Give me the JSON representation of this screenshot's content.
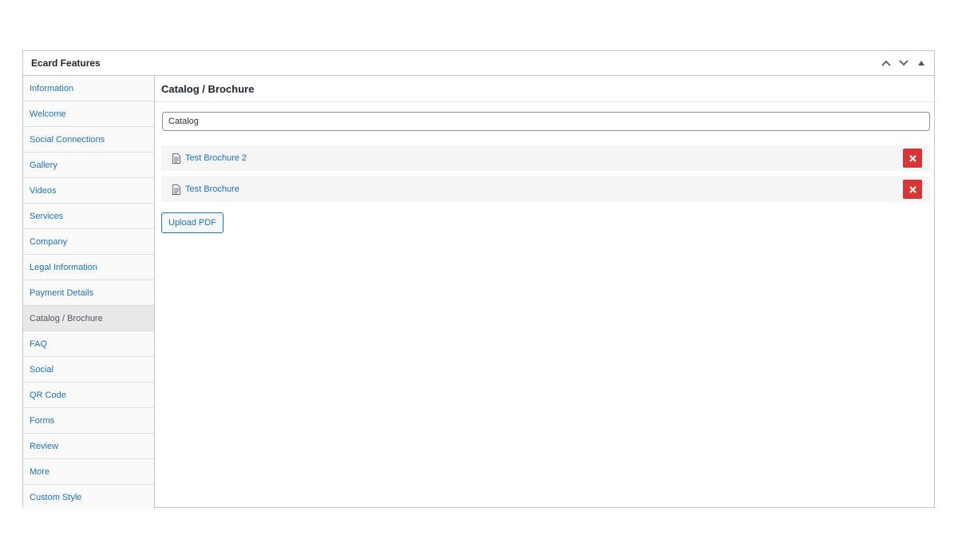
{
  "metabox": {
    "title": "Ecard Features",
    "controls": [
      "chevron-up-icon",
      "chevron-down-icon",
      "triangle-up-icon"
    ]
  },
  "tabs": [
    {
      "label": "Information"
    },
    {
      "label": "Welcome"
    },
    {
      "label": "Social Connections"
    },
    {
      "label": "Gallery"
    },
    {
      "label": "Videos"
    },
    {
      "label": "Services"
    },
    {
      "label": "Company"
    },
    {
      "label": "Legal Information"
    },
    {
      "label": "Payment Details"
    },
    {
      "label": "Catalog / Brochure",
      "active": true
    },
    {
      "label": "FAQ"
    },
    {
      "label": "Social"
    },
    {
      "label": "QR Code"
    },
    {
      "label": "Forms"
    },
    {
      "label": "Review"
    },
    {
      "label": "More"
    },
    {
      "label": "Custom Style"
    }
  ],
  "panel": {
    "title": "Catalog / Brochure",
    "title_input_value": "Catalog",
    "files": [
      {
        "name": "Test Brochure 2",
        "icon": "document-icon",
        "remove_icon": "close-icon"
      },
      {
        "name": "Test Brochure",
        "icon": "document-icon",
        "remove_icon": "close-icon"
      }
    ],
    "upload_label": "Upload PDF"
  },
  "colors": {
    "link": "#2271b1",
    "danger": "#d63638",
    "border": "#c3c4c7"
  }
}
